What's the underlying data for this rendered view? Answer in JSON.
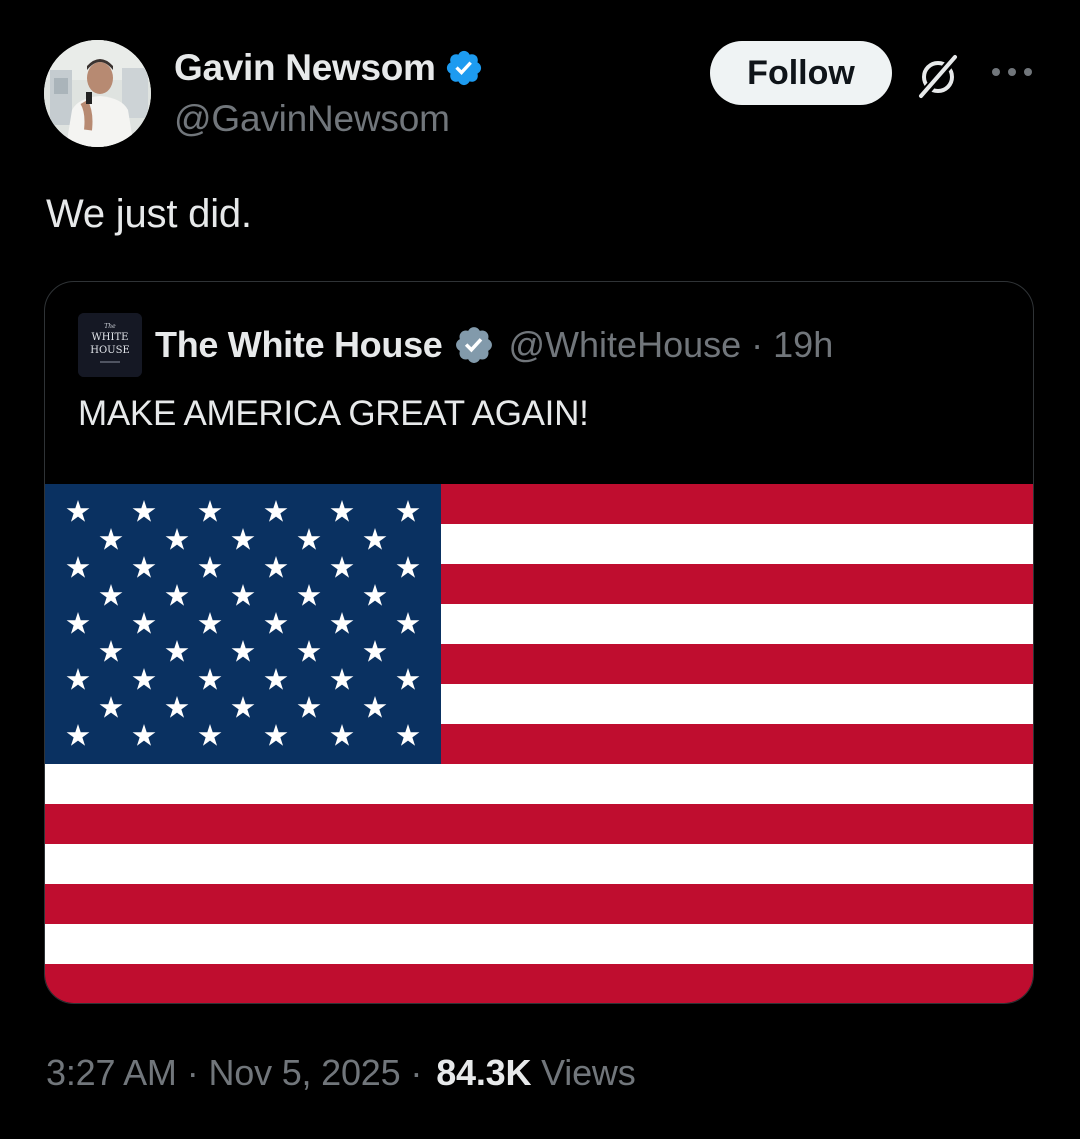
{
  "tweet": {
    "author": {
      "name": "Gavin Newsom",
      "handle": "@GavinNewsom",
      "verified_color": "#1d9bf0"
    },
    "follow_label": "Follow",
    "text": "We just did.",
    "footer": {
      "time": "3:27 AM",
      "date": "Nov 5, 2025",
      "views_count": "84.3K",
      "views_label": "Views"
    }
  },
  "quoted_tweet": {
    "name": "The White House",
    "handle": "@WhiteHouse",
    "age": "19h",
    "separator": "·",
    "text": "MAKE AMERICA GREAT AGAIN!",
    "verified_color": "#829aab",
    "avatar_logo_text": "The WHITE HOUSE",
    "media": {
      "description_icon": "us-flag-icon",
      "colors": {
        "red": "#bf0d2f",
        "white": "#ffffff",
        "blue": "#0a3161"
      }
    }
  },
  "icons": {
    "grok": "grok-icon",
    "more": "more-icon",
    "verified": "verified-badge-icon"
  }
}
